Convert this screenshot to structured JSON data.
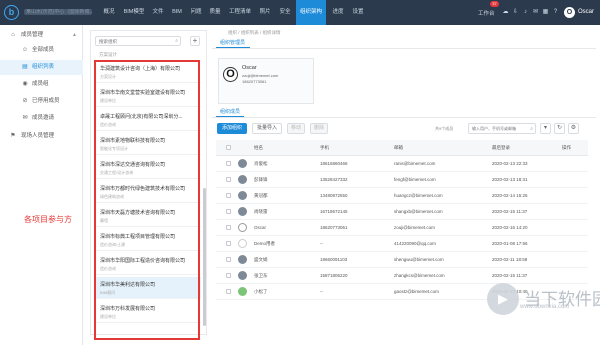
{
  "topbar": {
    "project": "某山水(示范)中心（国际新城...",
    "nav": [
      "概况",
      "BIM模型",
      "文件",
      "BIM",
      "问题",
      "质量",
      "工程清单",
      "照片",
      "安全",
      "组织架构",
      "进度",
      "设置"
    ],
    "active_nav_index": 9,
    "workspace": "工作台",
    "badge": "37",
    "user_initial": "O",
    "user_name": "Oscar"
  },
  "sidebar": {
    "title": "成员管理",
    "items": [
      {
        "label": "全部成员",
        "icon": "users-icon"
      },
      {
        "label": "组织列表",
        "icon": "org-icon"
      },
      {
        "label": "成员组",
        "icon": "group-icon"
      },
      {
        "label": "已停用成员",
        "icon": "user-disabled-icon"
      },
      {
        "label": "成员邀请",
        "icon": "invite-icon"
      }
    ],
    "section2": "现场人员管理"
  },
  "orglist": {
    "search_placeholder": "搜索组织",
    "add_label": "+",
    "top_role": "方案设计",
    "items": [
      {
        "name": "华润建筑设计咨询（上海）有限公司",
        "role": "方案设计"
      },
      {
        "name": "深圳市华南文堂营实验室建设有限公司",
        "role": "建设单位"
      },
      {
        "name": "卓晟工程顾问(北京)有限公司深圳分...",
        "role": "造价咨询"
      },
      {
        "name": "深圳市素地物联科技有限公司",
        "role": "智能化专项设计"
      },
      {
        "name": "深圳市深达交通咨询有限公司",
        "role": "交通工程/设计咨询"
      },
      {
        "name": "深圳市万都时代绿色建筑技术有限公司",
        "role": "绿色建筑咨询"
      },
      {
        "name": "深圳市天磊方塘技术咨询有限公司",
        "role": "幕墙"
      },
      {
        "name": "深圳市标典工程项目管理有限公司",
        "role": "造价咨询/土建"
      },
      {
        "name": "深圳市华阳国际工程造价咨询有限公司",
        "role": "造价咨询"
      },
      {
        "name": "深圳市华美利达有限公司",
        "role": "BIM顾问"
      },
      {
        "name": "深圳市万科发展有限公司",
        "role": "建设单位"
      }
    ],
    "selected_index": 9
  },
  "annotation": "各项目参与方",
  "main": {
    "breadcrumb": "组织 / 组织列表 / 组织详情",
    "tab1": "组织管理员",
    "admin": {
      "initial": "O",
      "name": "Oscar",
      "email": "zouji@bimemet.com",
      "phone": "18620773061"
    },
    "tab2": "组织成员",
    "buttons": {
      "add": "添加组织",
      "import": "批量导入",
      "move": "移动",
      "delete": "删除"
    },
    "count": "共9个成员",
    "search_placeholder": "输入用户、手机号或邮箱",
    "columns": [
      "姓名",
      "手机",
      "邮箱",
      "最后登录",
      "操作"
    ],
    "rows": [
      {
        "name": "肖俊松",
        "phone": "18616860466",
        "email": "ranis@bimemet.com",
        "last": "2020-02-13 22:33"
      },
      {
        "name": "彭锋锋",
        "phone": "13528427332",
        "email": "fengf@bimemet.com",
        "last": "2020-02-13 18:31"
      },
      {
        "name": "黄冠都",
        "phone": "13480872550",
        "email": "huangcz@bimemet.com",
        "last": "2020-02-14 15:26"
      },
      {
        "name": "尚晓雷",
        "phone": "16718672145",
        "email": "shangxb@bimemet.com",
        "last": "2020-02-15 11:37"
      },
      {
        "name": "Oscar",
        "phone": "18620773061",
        "email": "zouji@bimemet.com",
        "last": "2020-02-16 14:20"
      },
      {
        "name": "Demo用者",
        "phone": "--",
        "email": "414220090@qq.com",
        "last": "2020-01-08 17:56"
      },
      {
        "name": "盛文娟",
        "phone": "18660091103",
        "email": "shengwu@bimemet.com",
        "last": "2020-02-11 18:58"
      },
      {
        "name": "张卫东",
        "phone": "15871806220",
        "email": "zhangkcs@bimemet.com",
        "last": "2020-02-15 11:37"
      },
      {
        "name": "小松了",
        "phone": "--",
        "email": "gaostz@bimemet.com",
        "last": "2020-02-13 10:40"
      }
    ]
  },
  "watermark": {
    "text": "当下软件园",
    "url": "www.downxia.com"
  },
  "colors": {
    "topbar": "#2b3a4d",
    "accent": "#1e8bd8",
    "annotation": "#e53935"
  }
}
